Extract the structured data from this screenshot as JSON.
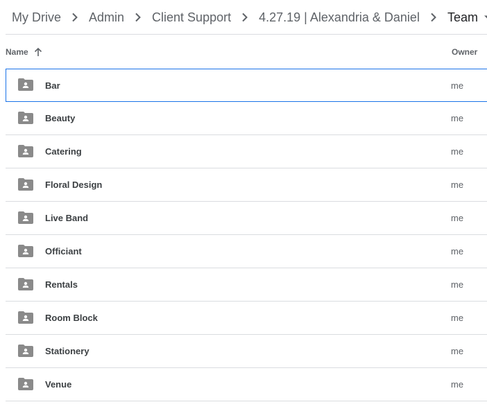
{
  "breadcrumb": {
    "items": [
      {
        "label": "My Drive"
      },
      {
        "label": "Admin"
      },
      {
        "label": "Client Support"
      },
      {
        "label": "4.27.19 | Alexandria & Daniel"
      },
      {
        "label": "Team"
      }
    ],
    "separator_icon": "chevron-right-icon",
    "dropdown_icon": "caret-down-icon"
  },
  "header": {
    "name_label": "Name",
    "sort_icon": "arrow-up-icon",
    "owner_label": "Owner"
  },
  "rows": [
    {
      "name": "Bar",
      "owner": "me",
      "selected": true
    },
    {
      "name": "Beauty",
      "owner": "me"
    },
    {
      "name": "Catering",
      "owner": "me"
    },
    {
      "name": "Floral Design",
      "owner": "me"
    },
    {
      "name": "Live Band",
      "owner": "me"
    },
    {
      "name": "Officiant",
      "owner": "me"
    },
    {
      "name": "Rentals",
      "owner": "me"
    },
    {
      "name": "Room Block",
      "owner": "me"
    },
    {
      "name": "Stationery",
      "owner": "me"
    },
    {
      "name": "Venue",
      "owner": "me"
    }
  ],
  "colors": {
    "selection_border": "#1a73e8",
    "folder_icon": "#8a8a8a",
    "divider": "#dadce0"
  }
}
